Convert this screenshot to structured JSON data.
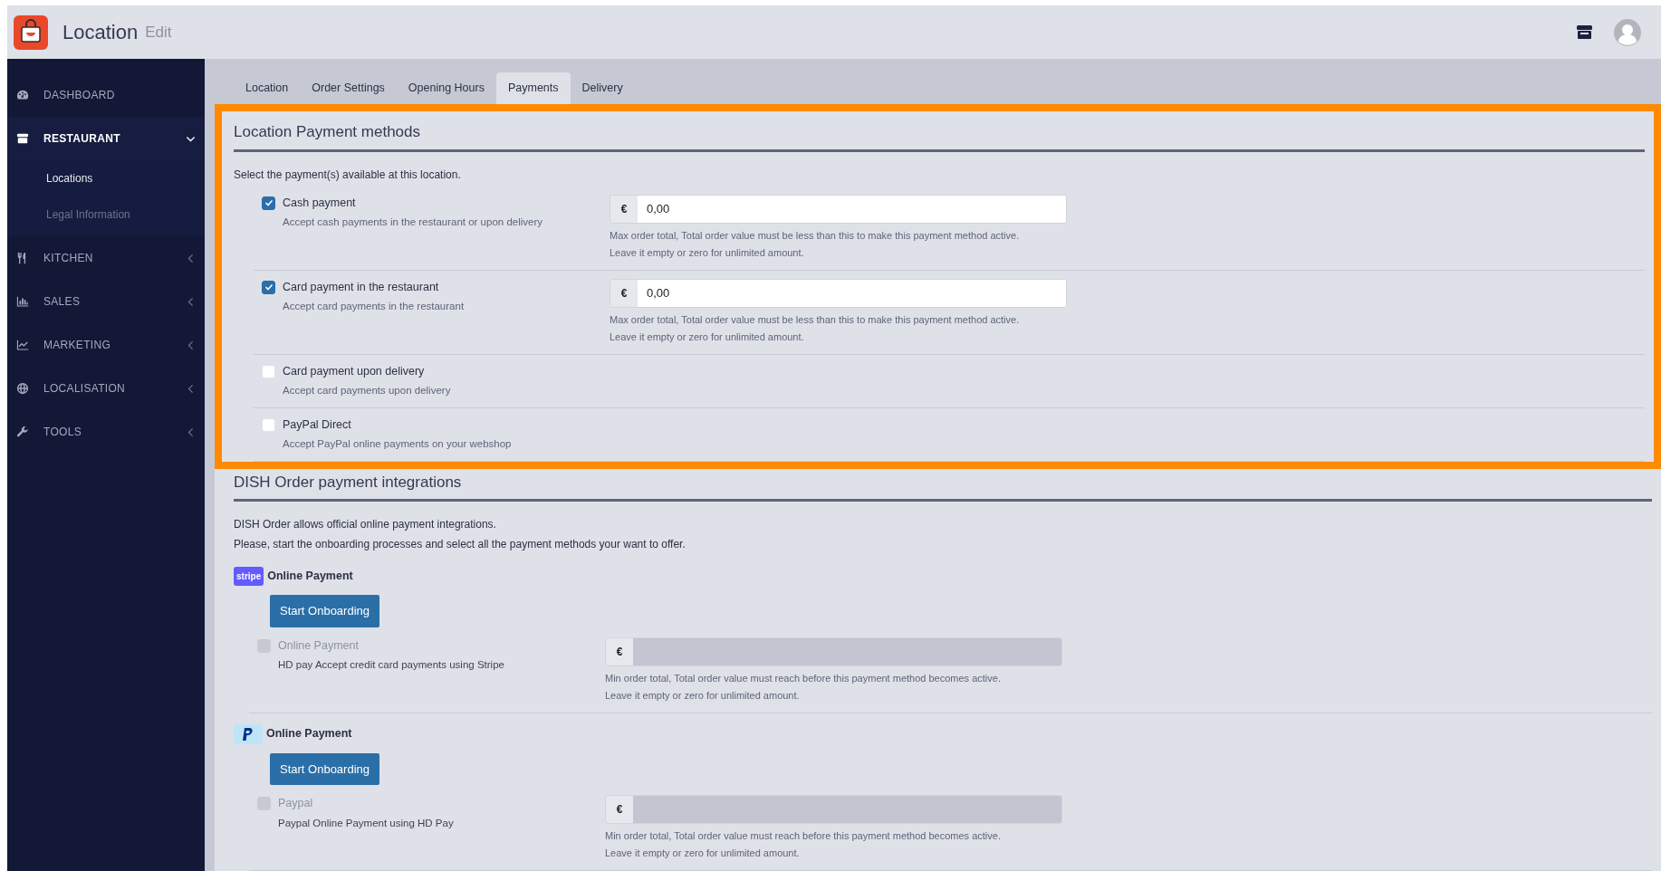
{
  "header": {
    "title": "Location",
    "subtitle": "Edit"
  },
  "sidebar": {
    "items": [
      {
        "label": "DASHBOARD"
      },
      {
        "label": "RESTAURANT",
        "expanded": true,
        "children": [
          {
            "label": "Locations",
            "selected": true
          },
          {
            "label": "Legal Information",
            "selected": false
          }
        ]
      },
      {
        "label": "KITCHEN",
        "expanded": false
      },
      {
        "label": "SALES",
        "expanded": false
      },
      {
        "label": "MARKETING",
        "expanded": false
      },
      {
        "label": "LOCALISATION",
        "expanded": false
      },
      {
        "label": "TOOLS",
        "expanded": false
      }
    ]
  },
  "tabs": [
    {
      "label": "Location",
      "selected": false
    },
    {
      "label": "Order Settings",
      "selected": false
    },
    {
      "label": "Opening Hours",
      "selected": false
    },
    {
      "label": "Payments",
      "selected": true
    },
    {
      "label": "Delivery",
      "selected": false
    }
  ],
  "location_payment_methods": {
    "title": "Location Payment methods",
    "highlighted": true,
    "intro": "Select the payment(s) available at this location.",
    "methods": [
      {
        "label": "Cash payment",
        "description": "Accept cash payments in the restaurant or upon delivery",
        "checked": true,
        "amount": {
          "currency": "€",
          "value": "0,00"
        },
        "help": [
          "Max order total, Total order value must be less than this to make this payment method active.",
          "Leave it empty or zero for unlimited amount."
        ]
      },
      {
        "label": "Card payment in the restaurant",
        "description": "Accept card payments in the restaurant",
        "checked": true,
        "amount": {
          "currency": "€",
          "value": "0,00"
        },
        "help": [
          "Max order total, Total order value must be less than this to make this payment method active.",
          "Leave it empty or zero for unlimited amount."
        ]
      },
      {
        "label": "Card payment upon delivery",
        "description": "Accept card payments upon delivery",
        "checked": false
      },
      {
        "label": "PayPal Direct",
        "description": "Accept PayPal online payments on your webshop",
        "checked": false
      }
    ]
  },
  "integrations": {
    "title": "DISH Order payment integrations",
    "intro": [
      "DISH Order allows official online payment integrations.",
      "Please, start the onboarding processes and select all the payment methods your want to offer."
    ],
    "providers": [
      {
        "kind": "stripe",
        "logo_text": "stripe",
        "title": "Online Payment",
        "button": "Start Onboarding",
        "method": {
          "label": "Online Payment",
          "description": "HD pay Accept credit card payments using Stripe",
          "checked": false,
          "disabled": true,
          "amount": {
            "currency": "€"
          },
          "help": [
            "Min order total, Total order value must reach before this payment method becomes active.",
            "Leave it empty or zero for unlimited amount."
          ]
        }
      },
      {
        "kind": "paypal",
        "title": "Online Payment",
        "button": "Start Onboarding",
        "method": {
          "label": "Paypal",
          "description": "Paypal Online Payment using HD Pay",
          "checked": false,
          "disabled": true,
          "amount": {
            "currency": "€"
          },
          "help": [
            "Min order total, Total order value must reach before this payment method becomes active.",
            "Leave it empty or zero for unlimited amount."
          ]
        }
      }
    ]
  }
}
